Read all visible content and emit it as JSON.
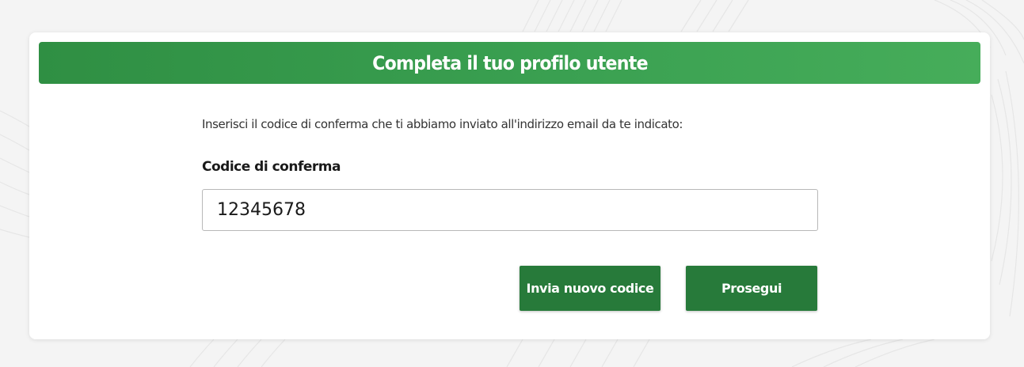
{
  "form": {
    "title": "Completa il tuo profilo utente",
    "instructions": "Inserisci il codice di conferma che ti abbiamo inviato all'indirizzo email da te indicato:",
    "code_label": "Codice di conferma",
    "code_value": "12345678"
  },
  "buttons": {
    "resend_label": "Invia nuovo codice",
    "continue_label": "Prosegui"
  },
  "colors": {
    "header_green": "#3aa051",
    "button_green": "#277a3a",
    "page_background": "#f4f4f4"
  }
}
